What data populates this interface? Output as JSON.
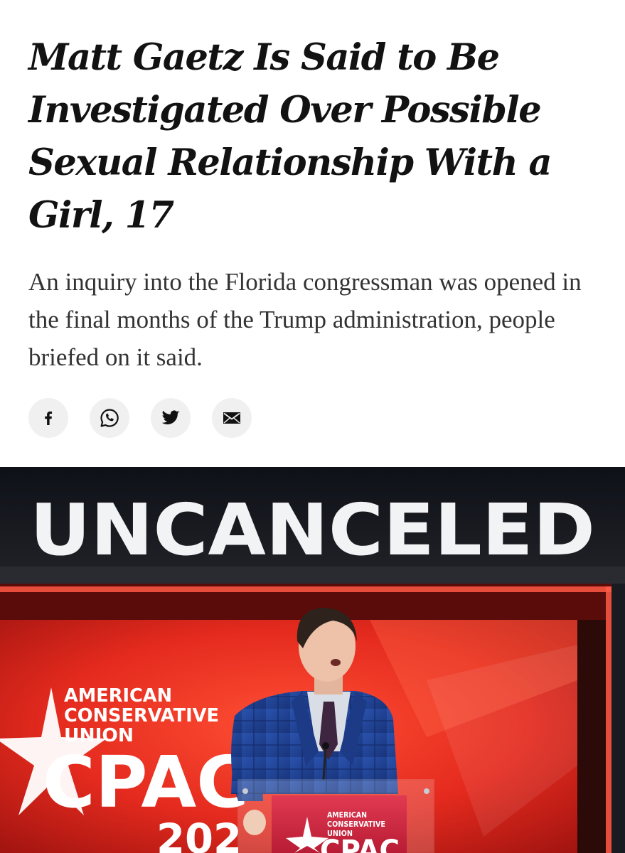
{
  "article": {
    "headline": "Matt Gaetz Is Said to Be Investigated Over Possible Sexual Relationship With a Girl, 17",
    "summary": "An inquiry into the Florida congressman was opened in the final months of the Trump administration, people briefed on it said."
  },
  "share": {
    "buttons": [
      {
        "icon": "facebook-icon"
      },
      {
        "icon": "whatsapp-icon"
      },
      {
        "icon": "twitter-icon"
      },
      {
        "icon": "email-icon"
      }
    ]
  },
  "photo": {
    "banner_text": "UNCANCELED",
    "screen_org_line1": "AMERICAN",
    "screen_org_line2": "CONSERVATIVE",
    "screen_org_line3": "UNION",
    "screen_logo": "CPAC",
    "screen_year": "202",
    "podium_line1": "AMERICAN",
    "podium_line2": "CONSERVATIVE",
    "podium_line3": "UNION",
    "podium_logo": "CPAC"
  },
  "colors": {
    "text": "#121212",
    "summary": "#333333",
    "share_bg": "#f0f0f0",
    "stage_red": "#d4231b",
    "suit_blue": "#1f3f8c"
  }
}
